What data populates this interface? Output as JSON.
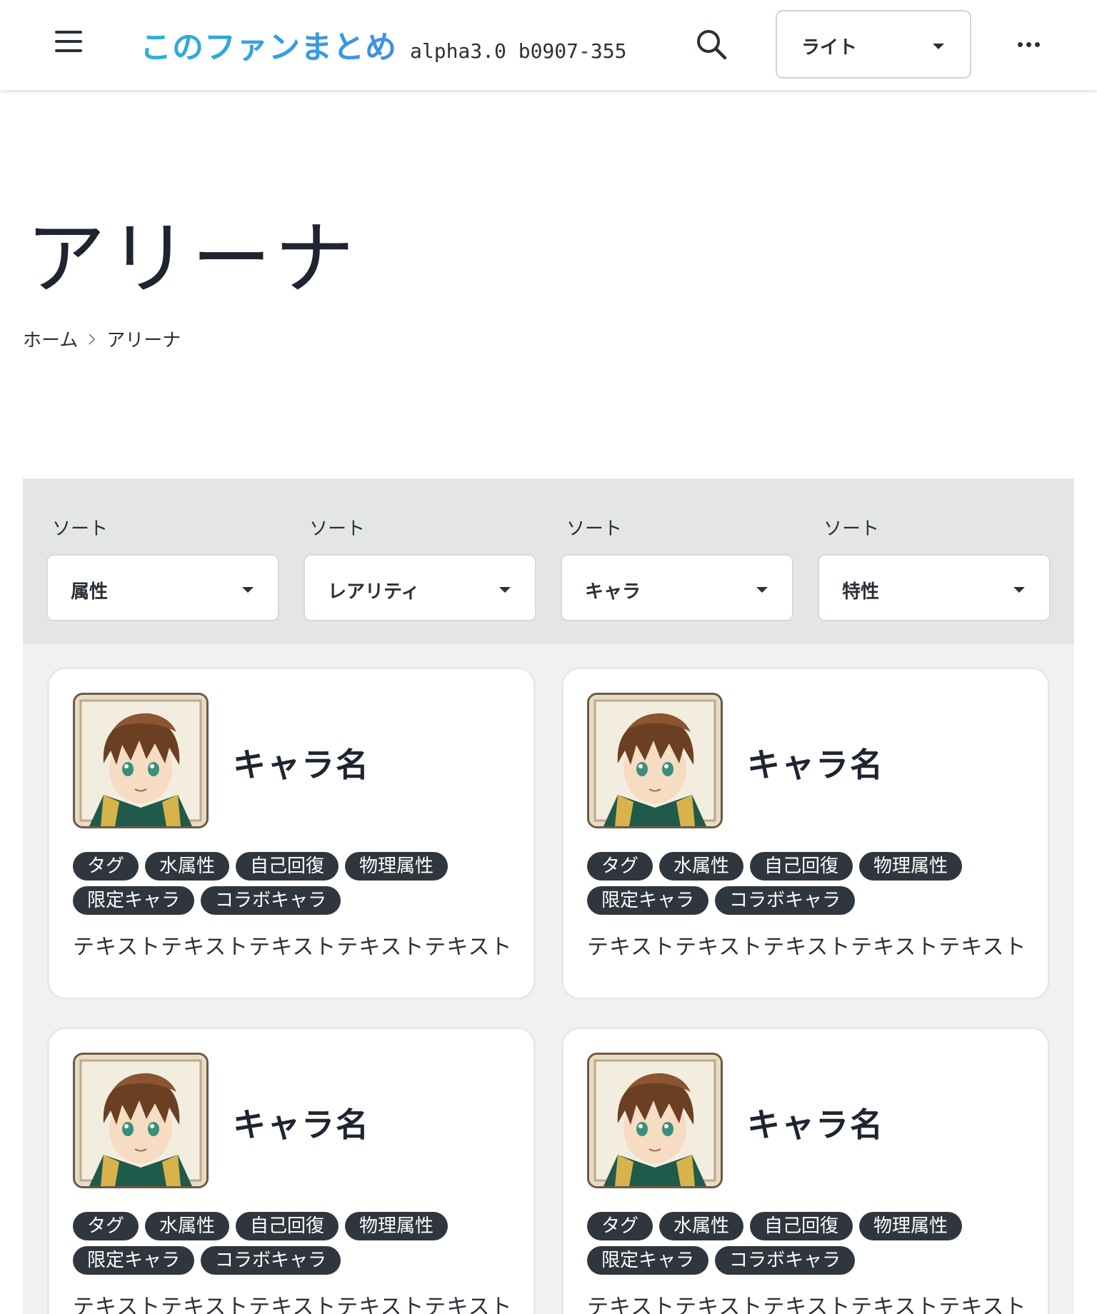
{
  "header": {
    "site_title": "このファンまとめ",
    "version": "alpha3.0 b0907-355",
    "theme": {
      "selected": "ライト"
    }
  },
  "page": {
    "title": "アリーナ",
    "breadcrumb": [
      "ホーム",
      "アリーナ"
    ]
  },
  "filters": [
    {
      "label": "ソート",
      "selected": "属性"
    },
    {
      "label": "ソート",
      "selected": "レアリティ"
    },
    {
      "label": "ソート",
      "selected": "キャラ"
    },
    {
      "label": "ソート",
      "selected": "特性"
    }
  ],
  "cards": [
    {
      "name": "キャラ名",
      "tags": [
        "タグ",
        "水属性",
        "自己回復",
        "物理属性",
        "限定キャラ",
        "コラボキャラ"
      ],
      "text": "テキストテキストテキストテキストテキスト"
    },
    {
      "name": "キャラ名",
      "tags": [
        "タグ",
        "水属性",
        "自己回復",
        "物理属性",
        "限定キャラ",
        "コラボキャラ"
      ],
      "text": "テキストテキストテキストテキストテキスト"
    },
    {
      "name": "キャラ名",
      "tags": [
        "タグ",
        "水属性",
        "自己回復",
        "物理属性",
        "限定キャラ",
        "コラボキャラ"
      ],
      "text": "テキストテキストテキストテキストテキスト"
    },
    {
      "name": "キャラ名",
      "tags": [
        "タグ",
        "水属性",
        "自己回復",
        "物理属性",
        "限定キャラ",
        "コラボキャラ"
      ],
      "text": "テキストテキストテキストテキストテキスト"
    }
  ],
  "icons": {
    "menu": "hamburger-icon",
    "search": "search-icon",
    "more": "more-horizontal-icon",
    "chevron": "chevron-right-icon",
    "dropdown": "caret-down-icon"
  },
  "colors": {
    "brand_gradient_start": "#2ab1d8",
    "brand_gradient_end": "#3f8fe6",
    "tag_background": "#30363e",
    "filter_bar_background": "#e4e6e6"
  }
}
